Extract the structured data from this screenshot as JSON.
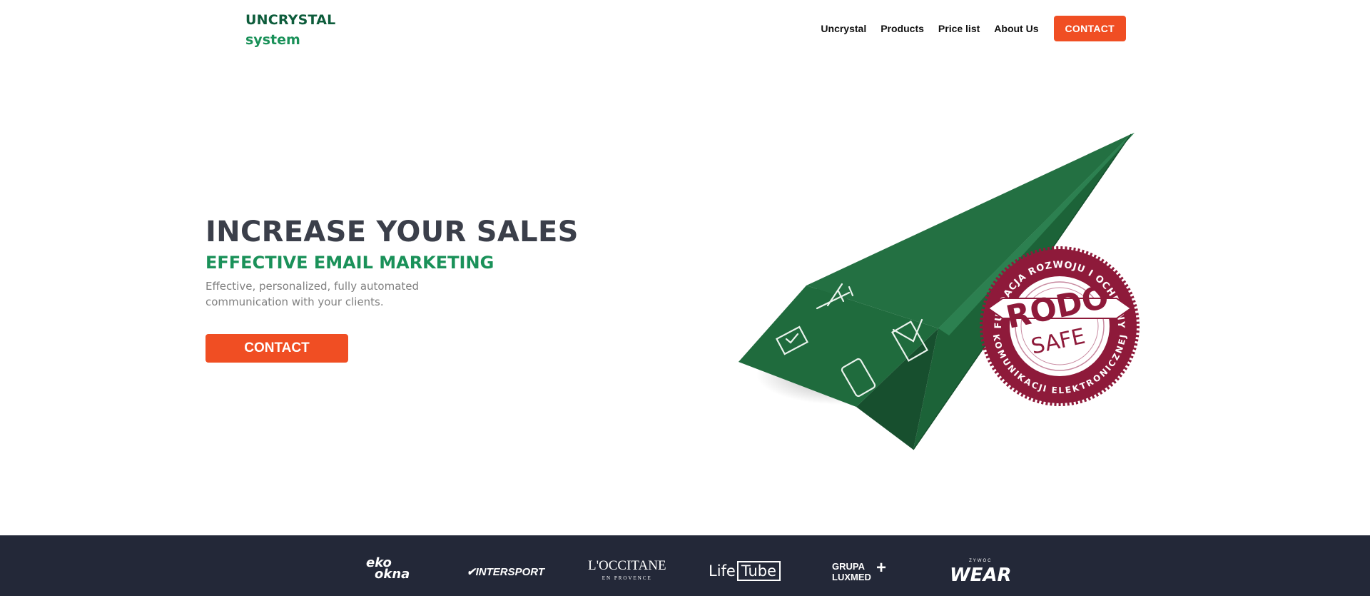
{
  "logo": {
    "line1": "UNCRYSTAL",
    "line2": "system"
  },
  "nav": {
    "items": [
      {
        "label": "Uncrystal"
      },
      {
        "label": "Products"
      },
      {
        "label": "Price list"
      },
      {
        "label": "About Us"
      }
    ],
    "cta_label": "CONTACT"
  },
  "hero": {
    "title": "INCREASE YOUR SALES",
    "subtitle": "EFFECTIVE EMAIL MARKETING",
    "description": "Effective, personalized, fully automated communication with your clients.",
    "cta_label": "CONTACT"
  },
  "badge": {
    "ring_text_top": "FUNDACJA ROZWOJU I OCHRONY",
    "ring_text_bottom": "KOMUNIKACJI ELEKTRONICZNEJ",
    "main": "RODO",
    "sub": "SAFE"
  },
  "clients": {
    "logos": [
      {
        "name": "ekookna-logo",
        "text1": "eko",
        "text2": "okna"
      },
      {
        "name": "intersport-logo",
        "text": "INTERSPORT"
      },
      {
        "name": "loccitane-logo",
        "text": "L'OCCITANE",
        "sub": "EN PROVENCE"
      },
      {
        "name": "lifetube-logo",
        "text1": "Life",
        "text2": "Tube"
      },
      {
        "name": "luxmed-logo",
        "text1": "GRUPA",
        "text2": "LUXMED"
      },
      {
        "name": "wear-logo",
        "text": "WEAR",
        "sub": "ZYWOC"
      }
    ]
  },
  "colors": {
    "accent": "#f04e23",
    "brand_green": "#1a9159",
    "plane_green": "#1f6b3d",
    "badge_red": "#8e1a3a",
    "footer_bg": "#232838"
  }
}
